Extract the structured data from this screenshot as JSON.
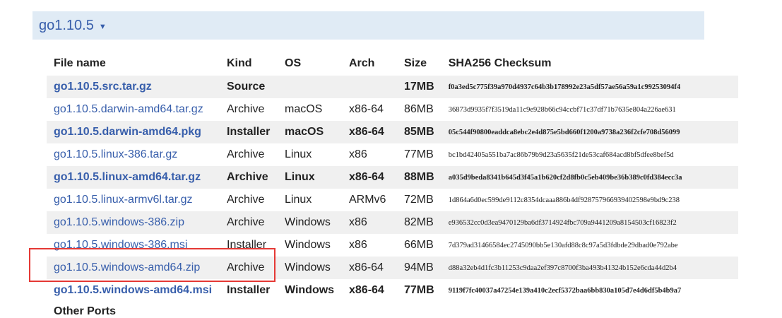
{
  "release": {
    "title": "go1.10.5",
    "caret_icon": "triangle-down"
  },
  "table": {
    "headers": {
      "file_name": "File name",
      "kind": "Kind",
      "os": "OS",
      "arch": "Arch",
      "size": "Size",
      "checksum": "SHA256 Checksum"
    },
    "rows": [
      {
        "file": "go1.10.5.src.tar.gz",
        "kind": "Source",
        "os": "",
        "arch": "",
        "size": "17MB",
        "checksum": "f0a3ed5c775f39a970d4937c64b3b178992e23a5df57ae56a59a1c99253094f4",
        "highlight": true
      },
      {
        "file": "go1.10.5.darwin-amd64.tar.gz",
        "kind": "Archive",
        "os": "macOS",
        "arch": "x86-64",
        "size": "86MB",
        "checksum": "36873d9935f7f3519da11c9e928b66c94ccbf71c37df71b7635e804a226ae631",
        "highlight": false
      },
      {
        "file": "go1.10.5.darwin-amd64.pkg",
        "kind": "Installer",
        "os": "macOS",
        "arch": "x86-64",
        "size": "85MB",
        "checksum": "05c544f90800eaddca8ebc2e4d875e5bd660f1200a9738a236f2cfe708d56099",
        "highlight": true
      },
      {
        "file": "go1.10.5.linux-386.tar.gz",
        "kind": "Archive",
        "os": "Linux",
        "arch": "x86",
        "size": "77MB",
        "checksum": "bc1bd42405a551ba7ac86b79b9d23a5635f21de53caf684acd8bf5dfee8bef5d",
        "highlight": false
      },
      {
        "file": "go1.10.5.linux-amd64.tar.gz",
        "kind": "Archive",
        "os": "Linux",
        "arch": "x86-64",
        "size": "88MB",
        "checksum": "a035d9beda8341b645d3f45a1b620cf2d8fb0c5eb409be36b389c0fd384ecc3a",
        "highlight": true
      },
      {
        "file": "go1.10.5.linux-armv6l.tar.gz",
        "kind": "Archive",
        "os": "Linux",
        "arch": "ARMv6",
        "size": "72MB",
        "checksum": "1d864a6d0ec599de9112c8354dcaaa886b4df928757966939402598e9bd9c238",
        "highlight": false
      },
      {
        "file": "go1.10.5.windows-386.zip",
        "kind": "Archive",
        "os": "Windows",
        "arch": "x86",
        "size": "82MB",
        "checksum": "e936532cc0d3ea9470129ba6df3714924fbc709a9441209a8154503cf16823f2",
        "highlight": false
      },
      {
        "file": "go1.10.5.windows-386.msi",
        "kind": "Installer",
        "os": "Windows",
        "arch": "x86",
        "size": "66MB",
        "checksum": "7d379ad31466584ec2745090bb5e130afd88c8c97a5d3fdbde29dbad0e792abe",
        "highlight": false
      },
      {
        "file": "go1.10.5.windows-amd64.zip",
        "kind": "Archive",
        "os": "Windows",
        "arch": "x86-64",
        "size": "94MB",
        "checksum": "d88a32eb4d1fc3b11253c9daa2ef397c8700f3ba493b41324b152e6cda44d2b4",
        "highlight": false
      },
      {
        "file": "go1.10.5.windows-amd64.msi",
        "kind": "Installer",
        "os": "Windows",
        "arch": "x86-64",
        "size": "77MB",
        "checksum": "9119f7fc40037a47254e139a410c2ecf5372baa6bb830a105d7e4d6df5b4b9a7",
        "highlight": true
      }
    ]
  },
  "next_section": {
    "title": "Other Ports"
  },
  "colors": {
    "header_bg": "#e0ebf5",
    "link": "#375eab",
    "row_alt_bg": "#f0f0f0",
    "callout_border": "#e53935"
  }
}
